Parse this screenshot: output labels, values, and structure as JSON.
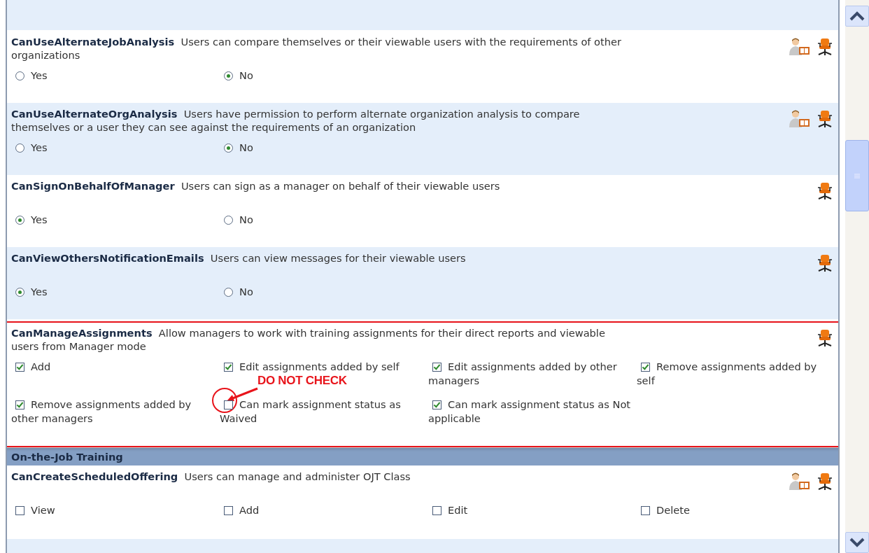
{
  "rows": [
    {
      "kind": "permission",
      "shaded": false,
      "highlighted": false,
      "name": "CanUseAlternateJobAnalysis",
      "description": "Users can compare themselves or their viewable users with the requirements of other organizations",
      "icons": [
        {
          "kind": "reader"
        },
        {
          "kind": "chair"
        }
      ],
      "options": [
        {
          "kind": "radio",
          "label": "Yes",
          "selected": false
        },
        {
          "kind": "radio",
          "label": "No",
          "selected": true
        }
      ]
    },
    {
      "kind": "permission",
      "shaded": true,
      "highlighted": false,
      "name": "CanUseAlternateOrgAnalysis",
      "description": "Users have permission to perform alternate organization analysis to compare themselves or a user they can see against the requirements of an organization",
      "icons": [
        {
          "kind": "reader"
        },
        {
          "kind": "chair"
        }
      ],
      "options": [
        {
          "kind": "radio",
          "label": "Yes",
          "selected": false
        },
        {
          "kind": "radio",
          "label": "No",
          "selected": true
        }
      ]
    },
    {
      "kind": "permission",
      "shaded": false,
      "highlighted": false,
      "name": "CanSignOnBehalfOfManager",
      "description": "Users can sign as a manager on behalf of their viewable users",
      "icons": [
        {
          "kind": "chair"
        }
      ],
      "options": [
        {
          "kind": "radio",
          "label": "Yes",
          "selected": true
        },
        {
          "kind": "radio",
          "label": "No",
          "selected": false
        }
      ]
    },
    {
      "kind": "permission",
      "shaded": true,
      "highlighted": false,
      "name": "CanViewOthersNotificationEmails",
      "description": "Users can view messages for their viewable users",
      "icons": [
        {
          "kind": "chair"
        }
      ],
      "options": [
        {
          "kind": "radio",
          "label": "Yes",
          "selected": true
        },
        {
          "kind": "radio",
          "label": "No",
          "selected": false
        }
      ]
    },
    {
      "kind": "permission",
      "shaded": false,
      "highlighted": true,
      "name": "CanManageAssignments",
      "description": "Allow managers to work with training assignments for their direct reports and viewable users from Manager mode",
      "icons": [
        {
          "kind": "chair"
        }
      ],
      "options": [
        {
          "kind": "checkbox",
          "label": "Add",
          "checked": true
        },
        {
          "kind": "checkbox",
          "label": "Edit assignments added by self",
          "checked": true
        },
        {
          "kind": "checkbox",
          "label": "Edit assignments added by other managers",
          "checked": true
        },
        {
          "kind": "checkbox",
          "label": "Remove assignments added by self",
          "checked": true
        },
        {
          "kind": "checkbox",
          "label": "Remove assignments added by other managers",
          "checked": true
        },
        {
          "kind": "checkbox",
          "label": "Can mark assignment status as Waived",
          "checked": false,
          "annotation": "DO NOT CHECK"
        },
        {
          "kind": "checkbox",
          "label": "Can mark assignment status as Not applicable",
          "checked": true
        }
      ]
    },
    {
      "kind": "section_header",
      "title": "On-the-Job Training"
    },
    {
      "kind": "permission",
      "shaded": false,
      "highlighted": false,
      "name": "CanCreateScheduledOffering",
      "description": "Users can manage and administer OJT Class",
      "icons": [
        {
          "kind": "reader"
        },
        {
          "kind": "chair"
        }
      ],
      "options": [
        {
          "kind": "checkbox",
          "label": "View",
          "checked": false
        },
        {
          "kind": "checkbox",
          "label": "Add",
          "checked": false
        },
        {
          "kind": "checkbox",
          "label": "Edit",
          "checked": false
        },
        {
          "kind": "checkbox",
          "label": "Delete",
          "checked": false
        }
      ]
    }
  ]
}
